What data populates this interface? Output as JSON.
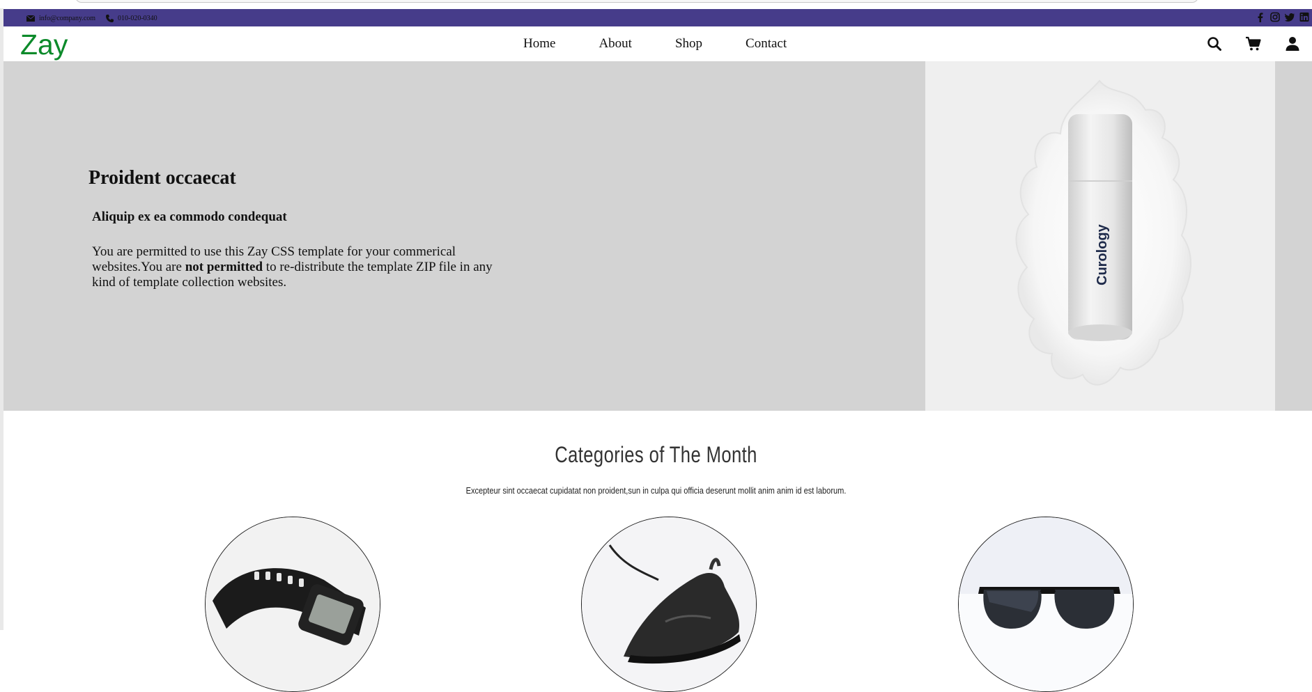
{
  "topbar": {
    "email": "info@company.com",
    "phone": "010-020-0340",
    "social_icons": [
      "facebook-icon",
      "instagram-icon",
      "twitter-icon",
      "linkedin-icon"
    ]
  },
  "navbar": {
    "logo": "Zay",
    "menu": [
      "Home",
      "About",
      "Shop",
      "Contact"
    ],
    "icons": [
      "search-icon",
      "cart-icon",
      "user-icon"
    ]
  },
  "hero": {
    "title": "Proident occaecat",
    "subtitle": "Aliquip ex ea commodo condequat",
    "text_before": "You are permitted to use this Zay CSS template for your commerical websites.You are ",
    "text_bold": "not permitted",
    "text_after": " to re-distribute the template ZIP file in any kind of template collection websites.",
    "product_label": "Curology"
  },
  "categories": {
    "title": "Categories of The Month",
    "subtitle": "Excepteur sint occaecat cupidatat non proident,sun in culpa qui officia deserunt mollit anim anim id est laborum.",
    "items": [
      "watch-image",
      "shoe-image",
      "sunglasses-image"
    ]
  },
  "colors": {
    "topbar": "#463c8a",
    "logo": "#0c8a2a",
    "hero_bg": "#d3d3d3"
  }
}
